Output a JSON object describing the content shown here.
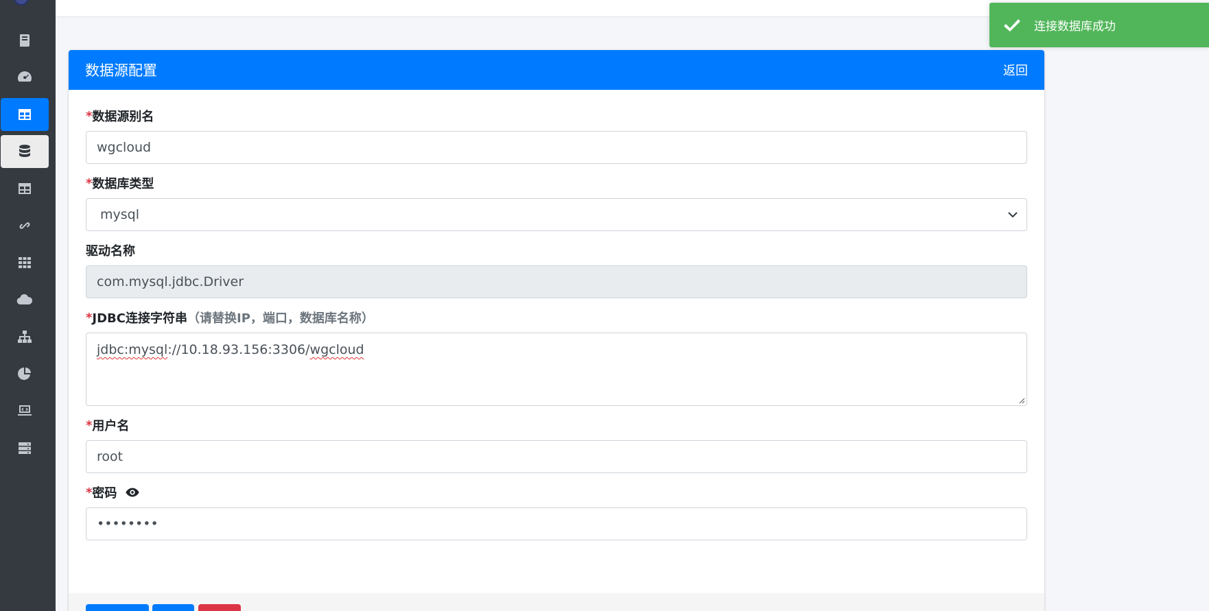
{
  "sidebar": {
    "items": [
      {
        "icon": "book-icon"
      },
      {
        "icon": "dashboard-gauge-icon"
      },
      {
        "icon": "table-icon",
        "active": true
      },
      {
        "icon": "database-icon",
        "hover": true
      },
      {
        "icon": "table-icon"
      },
      {
        "icon": "link-icon"
      },
      {
        "icon": "grid-icon"
      },
      {
        "icon": "cloud-icon"
      },
      {
        "icon": "sitemap-icon"
      },
      {
        "icon": "pie-chart-icon"
      },
      {
        "icon": "laptop-code-icon"
      },
      {
        "icon": "server-icon"
      }
    ]
  },
  "card": {
    "title": "数据源配置",
    "back_label": "返回"
  },
  "form": {
    "alias": {
      "required_mark": "*",
      "label": "数据源别名",
      "value": "wgcloud"
    },
    "db_type": {
      "required_mark": "*",
      "label": "数据库类型",
      "value": "mysql"
    },
    "driver": {
      "label": "驱动名称",
      "value": "com.mysql.jdbc.Driver"
    },
    "jdbc": {
      "required_mark": "*",
      "label": "JDBC连接字符串",
      "hint": "（请替换IP，端口，数据库名称）",
      "value_prefix": "jdbc:mysql",
      "value_middle": "://10.18.93.156:3306/",
      "value_suffix": "wgcloud"
    },
    "username": {
      "required_mark": "*",
      "label": "用户名",
      "value": "root"
    },
    "password": {
      "required_mark": "*",
      "label": "密码",
      "value": "••••••••"
    }
  },
  "toast": {
    "message": "连接数据库成功"
  },
  "colors": {
    "primary": "#007bff",
    "sidebar_bg": "#343a40",
    "success": "#51b65a",
    "danger": "#dc3545"
  }
}
